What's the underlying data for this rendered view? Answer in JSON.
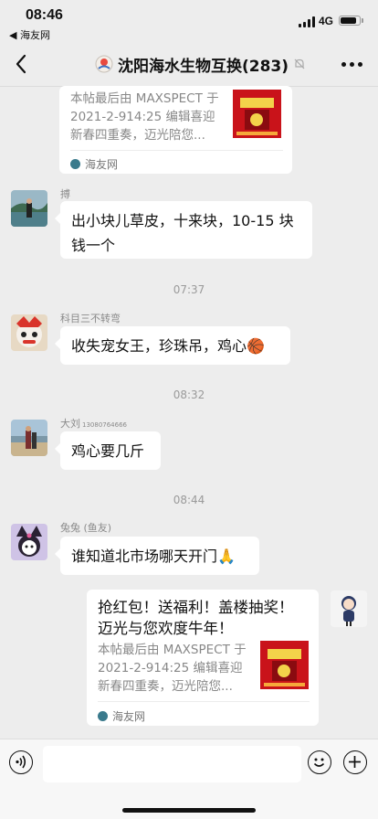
{
  "status_bar": {
    "time": "08:46",
    "back_app": "◀ 海友网",
    "network": "4G",
    "battery_level": 0.85
  },
  "nav": {
    "title": "沈阳海水生物互换(283)",
    "back_icon": "chevron-left-icon",
    "more_icon": "more-dots-icon",
    "mute_icon": "bell-off-icon"
  },
  "messages": [
    {
      "kind": "link_card_partial",
      "side": "left",
      "description": "本帖最后由 MAXSPECT于 2021-2-914:25 编辑喜迎 新春四重奏，迈光陪您...",
      "description_lines": [
        "本帖最后由 MAXSPECT 于",
        "2021-2-914:25 编辑喜迎",
        "新春四重奏，迈光陪您..."
      ],
      "source": "海友网"
    },
    {
      "kind": "text",
      "side": "left",
      "sender": "搏",
      "lines": [
        "出小块儿草皮，十来块，10-15 块",
        "钱一个"
      ]
    },
    {
      "kind": "time",
      "text": "07:37"
    },
    {
      "kind": "text",
      "side": "left",
      "sender": "科目三不转弯",
      "lines": [
        "收失宠女王，珍珠吊，鸡心🏀"
      ]
    },
    {
      "kind": "time",
      "text": "08:32"
    },
    {
      "kind": "text",
      "side": "left",
      "sender": "大刘",
      "sender_suffix": "13080764666",
      "lines": [
        "鸡心要几斤"
      ]
    },
    {
      "kind": "time",
      "text": "08:44"
    },
    {
      "kind": "text",
      "side": "left",
      "sender": "兔兔 (鱼友)",
      "lines": [
        "谁知道北市场哪天开门🙏"
      ]
    },
    {
      "kind": "link_card",
      "side": "right",
      "title_lines": [
        "抢红包！送福利！盖楼抽奖！",
        "迈光与您欢度牛年！"
      ],
      "description_lines": [
        "本帖最后由 MAXSPECT 于",
        "2021-2-914:25 编辑喜迎",
        "新春四重奏，迈光陪您..."
      ],
      "source": "海友网"
    }
  ],
  "input_bar": {
    "voice_icon": "voice-icon",
    "emoji_icon": "emoji-icon",
    "plus_icon": "plus-icon",
    "placeholder": ""
  },
  "colors": {
    "chat_background": "#ededed",
    "bubble": "#ffffff",
    "card_thumb": "#c9131a"
  }
}
